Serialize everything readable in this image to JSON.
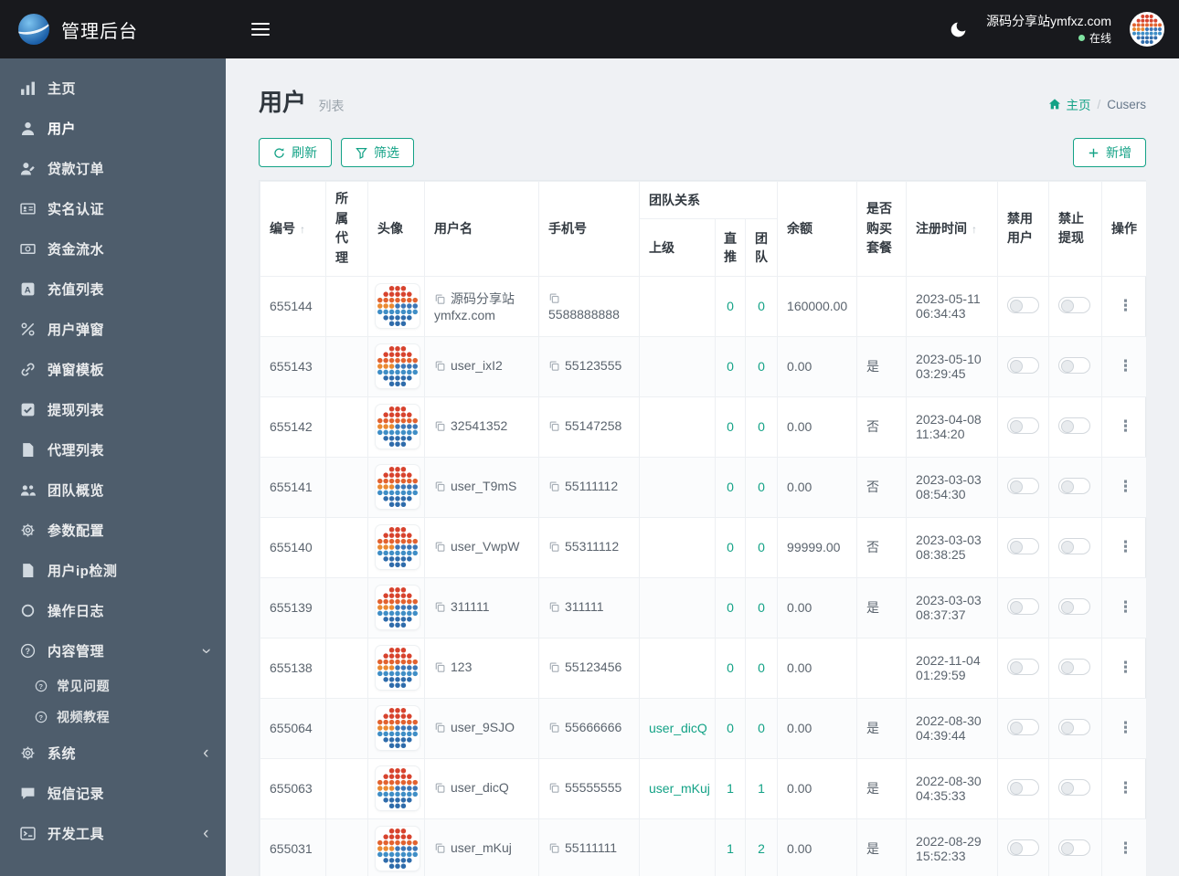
{
  "colors": {
    "accent": "#13a286",
    "topbar_bg": "#18191d",
    "sidebar_bg": "#4e5d6c",
    "page_bg": "#eff1f4",
    "online_dot": "#7fe3a1"
  },
  "brand": {
    "title": "管理后台"
  },
  "topbar": {
    "site_name": "源码分享站ymfxz.com",
    "online_status": "在线"
  },
  "icons": {
    "sort_asc": "↑",
    "row_actions": "⋮",
    "chevron": "‹",
    "breadcrumb_sep": "/"
  },
  "sidebar": {
    "items": [
      {
        "key": "home",
        "label": "主页",
        "icon": "chart-bars-icon"
      },
      {
        "key": "users",
        "label": "用户",
        "icon": "user-icon",
        "active": true
      },
      {
        "key": "loan-orders",
        "label": "贷款订单",
        "icon": "user-pen-icon"
      },
      {
        "key": "realname-auth",
        "label": "实名认证",
        "icon": "id-card-icon"
      },
      {
        "key": "fund-flow",
        "label": "资金流水",
        "icon": "money-icon"
      },
      {
        "key": "recharge-list",
        "label": "充值列表",
        "icon": "recharge-icon"
      },
      {
        "key": "user-popup",
        "label": "用户弹窗",
        "icon": "percent-icon"
      },
      {
        "key": "popup-template",
        "label": "弹窗模板",
        "icon": "link-icon"
      },
      {
        "key": "withdraw-list",
        "label": "提现列表",
        "icon": "check-square-icon"
      },
      {
        "key": "agent-list",
        "label": "代理列表",
        "icon": "file-icon"
      },
      {
        "key": "team-overview",
        "label": "团队概览",
        "icon": "team-icon"
      },
      {
        "key": "param-config",
        "label": "参数配置",
        "icon": "gears-icon"
      },
      {
        "key": "user-ip-check",
        "label": "用户ip检测",
        "icon": "file-icon"
      },
      {
        "key": "operation-log",
        "label": "操作日志",
        "icon": "circle-icon"
      },
      {
        "key": "content-mgmt",
        "label": "内容管理",
        "icon": "question-icon",
        "chevron": "down",
        "children": [
          {
            "key": "faq",
            "label": "常见问题",
            "icon": "question-icon"
          },
          {
            "key": "video-tutorial",
            "label": "视频教程",
            "icon": "question-icon"
          }
        ]
      },
      {
        "key": "system",
        "label": "系统",
        "icon": "gear-icon",
        "chevron": "left"
      },
      {
        "key": "sms-records",
        "label": "短信记录",
        "icon": "comment-icon"
      },
      {
        "key": "dev-tools",
        "label": "开发工具",
        "icon": "terminal-icon",
        "chevron": "left"
      }
    ]
  },
  "page": {
    "title": "用户",
    "subtitle": "列表",
    "breadcrumb": {
      "home": "主页",
      "current": "Cusers"
    }
  },
  "toolbar": {
    "refresh": "刷新",
    "filter": "筛选",
    "add": "新增"
  },
  "table": {
    "columns": {
      "id": "编号",
      "agent": "所属代理",
      "avatar": "头像",
      "username": "用户名",
      "phone": "手机号",
      "team_group": "团队关系",
      "superior": "上级",
      "direct": "直推",
      "team": "团队",
      "balance": "余额",
      "purchased": "是否购买套餐",
      "reg_time": "注册时间",
      "disable_user": "禁用用户",
      "forbid_withdraw": "禁止提现",
      "actions": "操作"
    },
    "rows": [
      {
        "id": "655144",
        "agent": "",
        "username": "源码分享站ymfxz.com",
        "phone": "5588888888",
        "superior": "",
        "direct": "0",
        "team": "0",
        "balance": "160000.00",
        "purchased": "",
        "reg_time": "2023-05-11 06:34:43"
      },
      {
        "id": "655143",
        "agent": "",
        "username": "user_ixI2",
        "phone": "55123555",
        "superior": "",
        "direct": "0",
        "team": "0",
        "balance": "0.00",
        "purchased": "是",
        "reg_time": "2023-05-10 03:29:45"
      },
      {
        "id": "655142",
        "agent": "",
        "username": "32541352",
        "phone": "55147258",
        "superior": "",
        "direct": "0",
        "team": "0",
        "balance": "0.00",
        "purchased": "否",
        "reg_time": "2023-04-08 11:34:20"
      },
      {
        "id": "655141",
        "agent": "",
        "username": "user_T9mS",
        "phone": "55111112",
        "superior": "",
        "direct": "0",
        "team": "0",
        "balance": "0.00",
        "purchased": "否",
        "reg_time": "2023-03-03 08:54:30"
      },
      {
        "id": "655140",
        "agent": "",
        "username": "user_VwpW",
        "phone": "55311112",
        "superior": "",
        "direct": "0",
        "team": "0",
        "balance": "99999.00",
        "purchased": "否",
        "reg_time": "2023-03-03 08:38:25"
      },
      {
        "id": "655139",
        "agent": "",
        "username": "311111",
        "phone": "311111",
        "superior": "",
        "direct": "0",
        "team": "0",
        "balance": "0.00",
        "purchased": "是",
        "reg_time": "2023-03-03 08:37:37"
      },
      {
        "id": "655138",
        "agent": "",
        "username": "123",
        "phone": "55123456",
        "superior": "",
        "direct": "0",
        "team": "0",
        "balance": "0.00",
        "purchased": "",
        "reg_time": "2022-11-04 01:29:59"
      },
      {
        "id": "655064",
        "agent": "",
        "username": "user_9SJO",
        "phone": "55666666",
        "superior": "user_dicQ",
        "direct": "0",
        "team": "0",
        "balance": "0.00",
        "purchased": "是",
        "reg_time": "2022-08-30 04:39:44"
      },
      {
        "id": "655063",
        "agent": "",
        "username": "user_dicQ",
        "phone": "55555555",
        "superior": "user_mKuj",
        "direct": "1",
        "team": "1",
        "balance": "0.00",
        "purchased": "是",
        "reg_time": "2022-08-30 04:35:33"
      },
      {
        "id": "655031",
        "agent": "",
        "username": "user_mKuj",
        "phone": "55111111",
        "superior": "",
        "direct": "1",
        "team": "2",
        "balance": "0.00",
        "purchased": "是",
        "reg_time": "2022-08-29 15:52:33"
      }
    ]
  }
}
